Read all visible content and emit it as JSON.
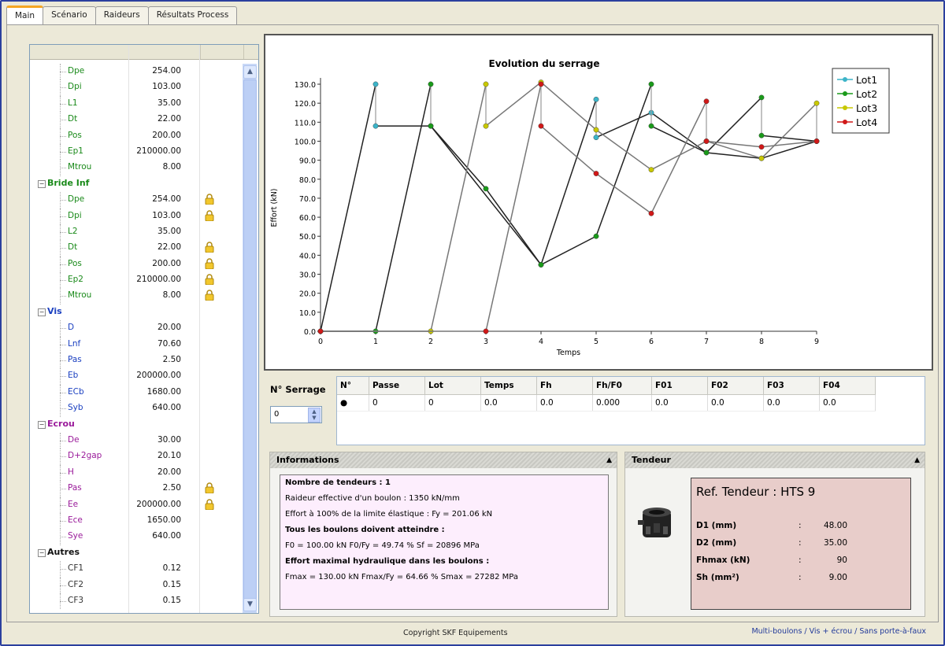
{
  "tabs": [
    "Main",
    "Scénario",
    "Raideurs",
    "Résultats Process"
  ],
  "tree": [
    {
      "type": "item",
      "name": "Dpe",
      "value": "254.00",
      "color": "#1a8a1a"
    },
    {
      "type": "item",
      "name": "Dpi",
      "value": "103.00",
      "color": "#1a8a1a"
    },
    {
      "type": "item",
      "name": "L1",
      "value": "35.00",
      "color": "#1a8a1a"
    },
    {
      "type": "item",
      "name": "Dt",
      "value": "22.00",
      "color": "#1a8a1a"
    },
    {
      "type": "item",
      "name": "Pos",
      "value": "200.00",
      "color": "#1a8a1a"
    },
    {
      "type": "item",
      "name": "Ep1",
      "value": "210000.00",
      "color": "#1a8a1a"
    },
    {
      "type": "item",
      "name": "Mtrou",
      "value": "8.00",
      "color": "#1a8a1a"
    },
    {
      "type": "group",
      "name": "Bride Inf",
      "color": "#1a8a1a"
    },
    {
      "type": "item",
      "name": "Dpe",
      "value": "254.00",
      "color": "#1a8a1a",
      "lock": true
    },
    {
      "type": "item",
      "name": "Dpi",
      "value": "103.00",
      "color": "#1a8a1a",
      "lock": true
    },
    {
      "type": "item",
      "name": "L2",
      "value": "35.00",
      "color": "#1a8a1a"
    },
    {
      "type": "item",
      "name": "Dt",
      "value": "22.00",
      "color": "#1a8a1a",
      "lock": true
    },
    {
      "type": "item",
      "name": "Pos",
      "value": "200.00",
      "color": "#1a8a1a",
      "lock": true
    },
    {
      "type": "item",
      "name": "Ep2",
      "value": "210000.00",
      "color": "#1a8a1a",
      "lock": true
    },
    {
      "type": "item",
      "name": "Mtrou",
      "value": "8.00",
      "color": "#1a8a1a",
      "lock": true
    },
    {
      "type": "group",
      "name": "Vis",
      "color": "#1a3fc0"
    },
    {
      "type": "item",
      "name": "D",
      "value": "20.00",
      "color": "#1a3fc0"
    },
    {
      "type": "item",
      "name": "Lnf",
      "value": "70.60",
      "color": "#1a3fc0"
    },
    {
      "type": "item",
      "name": "Pas",
      "value": "2.50",
      "color": "#1a3fc0"
    },
    {
      "type": "item",
      "name": "Eb",
      "value": "200000.00",
      "color": "#1a3fc0"
    },
    {
      "type": "item",
      "name": "ECb",
      "value": "1680.00",
      "color": "#1a3fc0"
    },
    {
      "type": "item",
      "name": "Syb",
      "value": "640.00",
      "color": "#1a3fc0"
    },
    {
      "type": "group",
      "name": "Ecrou",
      "color": "#9a1a9a"
    },
    {
      "type": "item",
      "name": "De",
      "value": "30.00",
      "color": "#9a1a9a"
    },
    {
      "type": "item",
      "name": "D+2gap",
      "value": "20.10",
      "color": "#9a1a9a"
    },
    {
      "type": "item",
      "name": "H",
      "value": "20.00",
      "color": "#9a1a9a"
    },
    {
      "type": "item",
      "name": "Pas",
      "value": "2.50",
      "color": "#9a1a9a",
      "lock": true
    },
    {
      "type": "item",
      "name": "Ee",
      "value": "200000.00",
      "color": "#9a1a9a",
      "lock": true
    },
    {
      "type": "item",
      "name": "Ece",
      "value": "1650.00",
      "color": "#9a1a9a"
    },
    {
      "type": "item",
      "name": "Sye",
      "value": "640.00",
      "color": "#9a1a9a"
    },
    {
      "type": "group",
      "name": "Autres",
      "color": "#111111"
    },
    {
      "type": "item",
      "name": "CF1",
      "value": "0.12",
      "color": "#333333"
    },
    {
      "type": "item",
      "name": "CF2",
      "value": "0.15",
      "color": "#333333"
    },
    {
      "type": "item",
      "name": "CF3",
      "value": "0.15",
      "color": "#333333"
    }
  ],
  "chart_data": {
    "type": "line",
    "title": "Evolution du serrage",
    "xlabel": "Temps",
    "ylabel": "Effort (kN)",
    "xlim": [
      0,
      9
    ],
    "ylim": [
      0,
      130
    ],
    "yticks": [
      "0.0",
      "10.0",
      "20.0",
      "30.0",
      "40.0",
      "50.0",
      "60.0",
      "70.0",
      "80.0",
      "90.0",
      "100.0",
      "110.0",
      "120.0",
      "130.0"
    ],
    "xticks": [
      "0",
      "1",
      "2",
      "3",
      "4",
      "5",
      "6",
      "7",
      "8",
      "9"
    ],
    "legend_position": "top-right",
    "series": [
      {
        "name": "Lot1",
        "color": "#3cb4c8",
        "points": [
          [
            0,
            0
          ],
          [
            1,
            130
          ],
          [
            1,
            108
          ],
          [
            2,
            108
          ],
          [
            4,
            35
          ],
          [
            5,
            122
          ],
          [
            5,
            102
          ],
          [
            6,
            115
          ],
          [
            7,
            94
          ],
          [
            8,
            91
          ],
          [
            9,
            100
          ]
        ]
      },
      {
        "name": "Lot2",
        "color": "#1a9a1a",
        "points": [
          [
            0,
            0
          ],
          [
            1,
            0
          ],
          [
            2,
            130
          ],
          [
            2,
            108
          ],
          [
            3,
            75
          ],
          [
            4,
            35
          ],
          [
            5,
            50
          ],
          [
            6,
            130
          ],
          [
            6,
            108
          ],
          [
            7,
            94
          ],
          [
            8,
            123
          ],
          [
            8,
            103
          ],
          [
            9,
            100
          ]
        ]
      },
      {
        "name": "Lot3",
        "color": "#c8c800",
        "points": [
          [
            0,
            0
          ],
          [
            2,
            0
          ],
          [
            3,
            130
          ],
          [
            3,
            108
          ],
          [
            4,
            131
          ],
          [
            5,
            106
          ],
          [
            6,
            85
          ],
          [
            7,
            100
          ],
          [
            8,
            91
          ],
          [
            9,
            120
          ],
          [
            9,
            100
          ]
        ]
      },
      {
        "name": "Lot4",
        "color": "#d01818",
        "points": [
          [
            0,
            0
          ],
          [
            3,
            0
          ],
          [
            4,
            130
          ],
          [
            4,
            108
          ],
          [
            5,
            83
          ],
          [
            6,
            62
          ],
          [
            7,
            121
          ],
          [
            7,
            100
          ],
          [
            8,
            97
          ],
          [
            9,
            100
          ]
        ]
      }
    ]
  },
  "serrage": {
    "label": "N° Serrage",
    "value": "0"
  },
  "grid": {
    "columns": [
      "N°",
      "Passe",
      "Lot",
      "Temps",
      "Fh",
      "Fh/F0",
      "F01",
      "F02",
      "F03",
      "F04"
    ],
    "row": [
      "●",
      "0",
      "0",
      "0.0",
      "0.0",
      "0.000",
      "0.0",
      "0.0",
      "0.0",
      "0.0"
    ]
  },
  "info": {
    "title": "Informations",
    "lines": [
      {
        "t": "Nombre de tendeurs : 1",
        "b": true
      },
      {
        "t": "Raideur effective d'un boulon :       1350 kN/mm",
        "b": false
      },
      {
        "t": "Effort à 100% de la limite élastique : Fy =   201.06 kN",
        "b": false
      },
      {
        "t": "Tous les boulons doivent atteindre :",
        "b": true
      },
      {
        "t": "F0 =   100.00 kN   F0/Fy = 49.74 %   Sf =     20896 MPa",
        "b": false
      },
      {
        "t": "Effort maximal hydraulique dans les boulons :",
        "b": true
      },
      {
        "t": "Fmax =    130.00 kN   Fmax/Fy = 64.66 %   Smax =     27282 MPa",
        "b": false
      }
    ]
  },
  "tendeur": {
    "title": "Tendeur",
    "ref": "Ref. Tendeur  : HTS 9",
    "rows": [
      {
        "label": "D1 (mm)",
        "value": "48.00"
      },
      {
        "label": "D2 (mm)",
        "value": "35.00"
      },
      {
        "label": "Fhmax (kN)",
        "value": "90"
      },
      {
        "label": "Sh (mm²)",
        "value": "9.00"
      }
    ]
  },
  "footer": {
    "copyright": "Copyright SKF Equipements",
    "note": "Multi-boulons / Vis + écrou / Sans porte-à-faux"
  }
}
